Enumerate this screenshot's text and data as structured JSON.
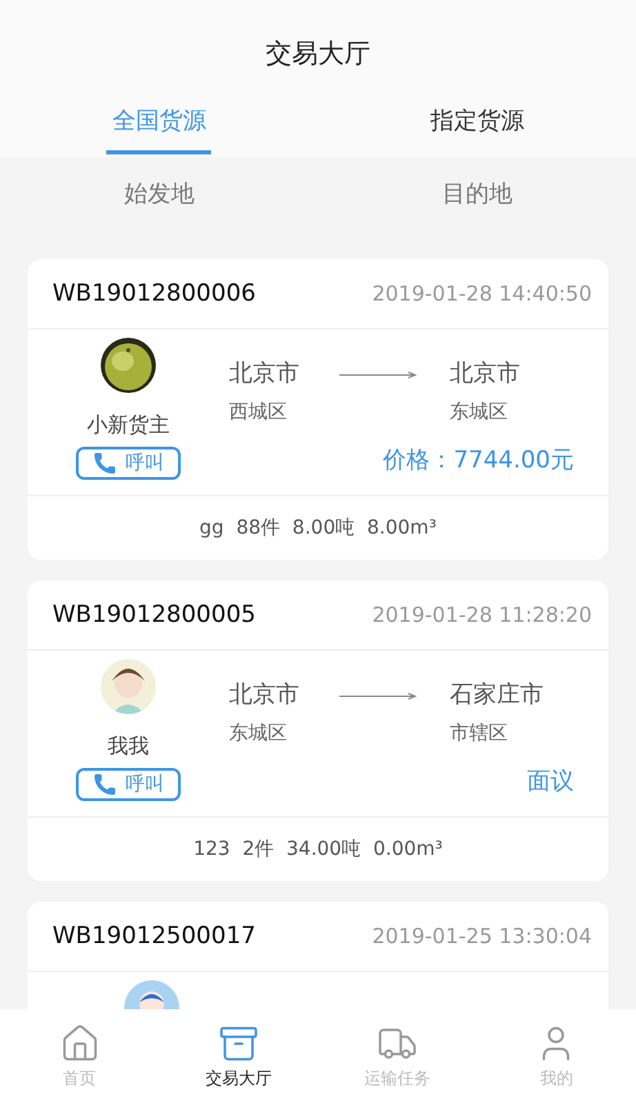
{
  "header": {
    "title": "交易大厅"
  },
  "tabs": [
    {
      "label": "全国货源",
      "selected": true
    },
    {
      "label": "指定货源",
      "selected": false
    }
  ],
  "filters": [
    "始发地",
    "目的地"
  ],
  "orders": [
    {
      "id": "WB19012800006",
      "time": "2019-01-28 14:40:50",
      "shipper": "小新货主",
      "call": "呼叫",
      "from_city": "北京市",
      "from_district": "西城区",
      "to_city": "北京市",
      "to_district": "东城区",
      "price": "价格：7744.00元",
      "cargo": "gg  88件  8.00吨  8.00m³"
    },
    {
      "id": "WB19012800005",
      "time": "2019-01-28 11:28:20",
      "avatar": {
        "kind": "figure"
      },
      "shipper": "我我",
      "call": "呼叫",
      "from_city": "北京市",
      "from_district": "东城区",
      "to_city": "石家庄市",
      "to_district": "市辖区",
      "price": "面议",
      "cargo": "123  2件  34.00吨  0.00m³"
    },
    {
      "id": "WB19012500017",
      "time": "2019-01-25 13:30:04",
      "avatar": {
        "kind": "default"
      }
    }
  ],
  "nav": [
    {
      "label": "首页",
      "kind": "home",
      "selected": false
    },
    {
      "label": "交易大厅",
      "kind": "hall",
      "selected": true
    },
    {
      "label": "运输任务",
      "kind": "truck",
      "selected": false
    },
    {
      "label": "我的",
      "kind": "user",
      "selected": false
    }
  ]
}
